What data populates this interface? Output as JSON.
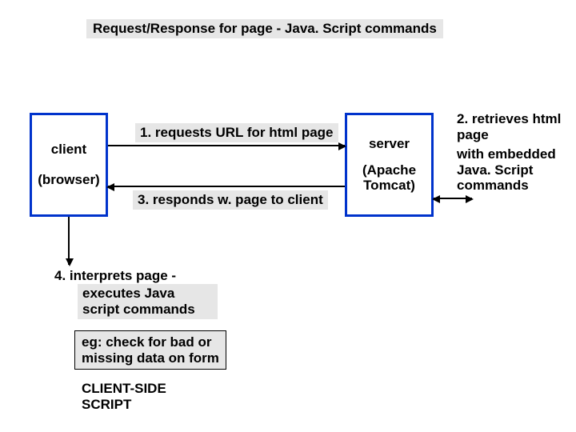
{
  "title": "Request/Response for page - Java. Script commands",
  "client": {
    "name": "client",
    "sub": "(browser)"
  },
  "server": {
    "name": "server",
    "sub": "(Apache Tomcat)"
  },
  "step1": "1. requests URL for html page",
  "step2": "2. retrieves html page",
  "step2b": "with embedded Java. Script commands",
  "step3": "3. responds w. page to client",
  "step4_a": "4. interprets page -",
  "step4_b": "executes Java script commands",
  "note": "eg: check for bad or missing data on form",
  "footer": "CLIENT-SIDE SCRIPT"
}
